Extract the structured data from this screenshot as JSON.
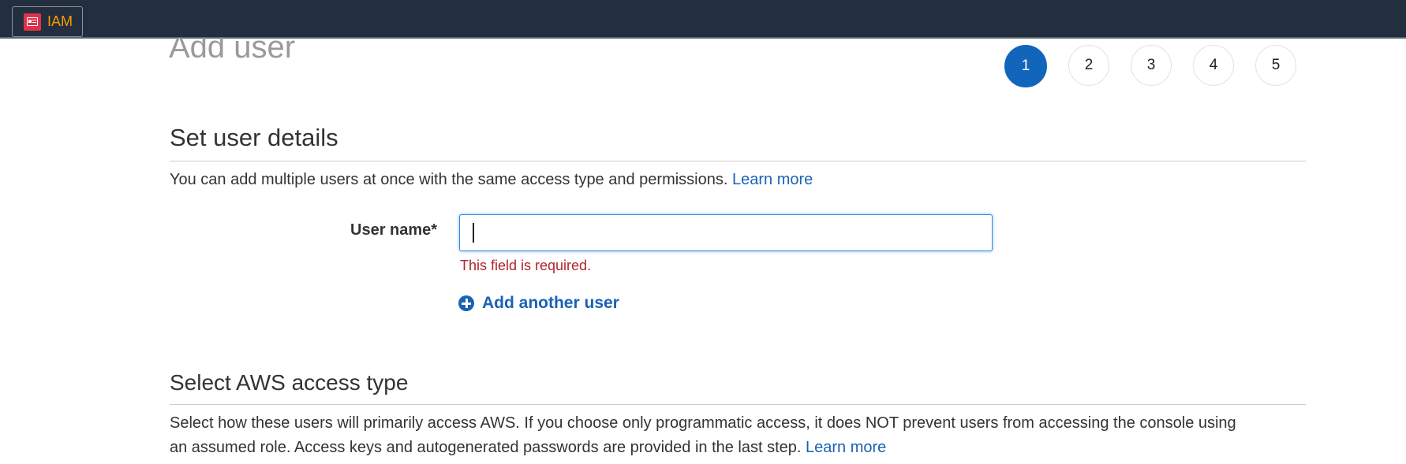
{
  "topbar": {
    "service_icon": "iam-icon",
    "service_label": "IAM"
  },
  "page": {
    "title": "Add user"
  },
  "steps": [
    {
      "label": "1",
      "active": true
    },
    {
      "label": "2",
      "active": false
    },
    {
      "label": "3",
      "active": false
    },
    {
      "label": "4",
      "active": false
    },
    {
      "label": "5",
      "active": false
    }
  ],
  "user_details": {
    "heading": "Set user details",
    "description": "You can add multiple users at once with the same access type and permissions.",
    "learn_more": "Learn more",
    "username_label": "User name*",
    "username_value": "",
    "username_error": "This field is required.",
    "add_another_user": "Add another user"
  },
  "access_type": {
    "heading": "Select AWS access type",
    "description_line1": "Select how these users will primarily access AWS. If you choose only programmatic access, it does NOT prevent users from accessing the console using",
    "description_line2": "an assumed role. Access keys and autogenerated passwords are provided in the last step.",
    "learn_more": "Learn more"
  },
  "colors": {
    "topbar": "#232f3e",
    "service_accent": "#ff9900",
    "link": "#1a62b4",
    "active_step": "#1166bb",
    "error": "#b0242a"
  }
}
